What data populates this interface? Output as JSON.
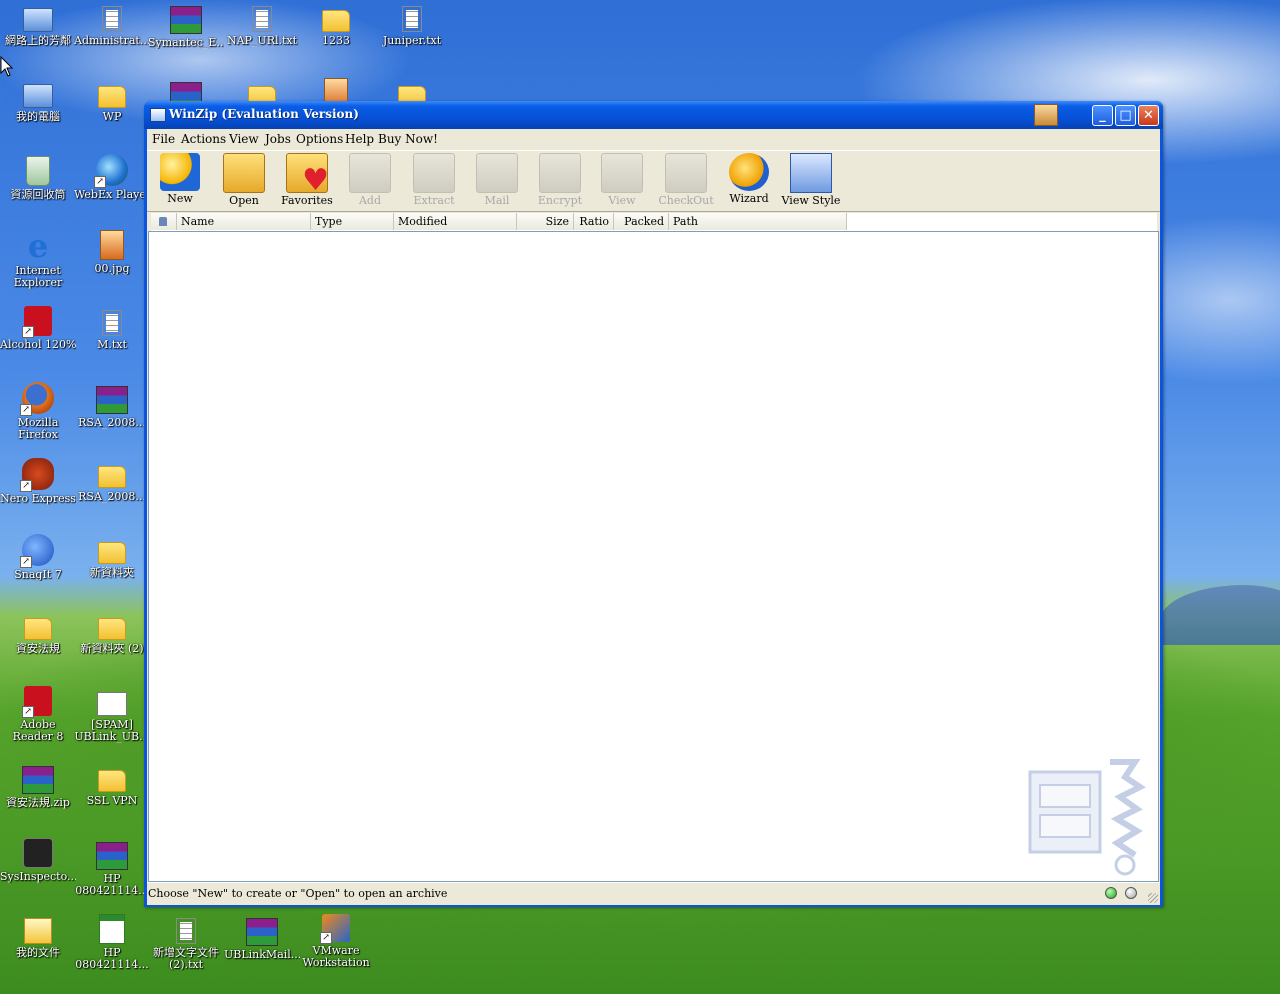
{
  "desktop": {
    "icons": [
      {
        "label": "網路上的芳鄰",
        "icon": "network-icon"
      },
      {
        "label": "Administrat...",
        "icon": "text-icon"
      },
      {
        "label": "Symantec_E...",
        "icon": "rar-icon"
      },
      {
        "label": "NAP_URl.txt",
        "icon": "text-icon"
      },
      {
        "label": "1233",
        "icon": "folder-icon"
      },
      {
        "label": "Juniper.txt",
        "icon": "text-icon"
      },
      {
        "label": "我的電腦",
        "icon": "computer-icon"
      },
      {
        "label": "WP",
        "icon": "folder-icon"
      },
      {
        "label": "資源回收筒",
        "icon": "recycle-bin-icon"
      },
      {
        "label": "WebEx Player",
        "icon": "webex-icon"
      },
      {
        "label": "Internet Explorer",
        "icon": "ie-icon"
      },
      {
        "label": "00.jpg",
        "icon": "image-icon"
      },
      {
        "label": "Alcohol 120%",
        "icon": "alcohol-icon"
      },
      {
        "label": "M.txt",
        "icon": "text-icon"
      },
      {
        "label": "Mozilla Firefox",
        "icon": "firefox-icon"
      },
      {
        "label": "RSA_2008...",
        "icon": "rar-icon"
      },
      {
        "label": "Nero Express",
        "icon": "nero-icon"
      },
      {
        "label": "RSA_2008...",
        "icon": "folder-icon"
      },
      {
        "label": "SnagIt 7",
        "icon": "snagit-icon"
      },
      {
        "label": "新資料夾",
        "icon": "folder-icon"
      },
      {
        "label": "資安法規",
        "icon": "folder-icon"
      },
      {
        "label": "新資料夾 (2)",
        "icon": "folder-icon"
      },
      {
        "label": "Adobe Reader 8",
        "icon": "adobe-reader-icon"
      },
      {
        "label": "[SPAM] UBLink_UB...",
        "icon": "mail-icon"
      },
      {
        "label": "資安法規.zip",
        "icon": "rar-icon"
      },
      {
        "label": "SSL VPN",
        "icon": "folder-icon"
      },
      {
        "label": "SysInspecto...",
        "icon": "sysinspector-icon"
      },
      {
        "label": "HP 080421114...",
        "icon": "rar-icon"
      },
      {
        "label": "我的文件",
        "icon": "documents-icon"
      },
      {
        "label": "HP 080421114...",
        "icon": "excel-icon"
      },
      {
        "label": "新增文字文件 (2).txt",
        "icon": "text-icon"
      },
      {
        "label": "UBLinkMail...",
        "icon": "rar-icon"
      },
      {
        "label": "VMware Workstation",
        "icon": "vmware-icon"
      }
    ]
  },
  "window": {
    "title": "WinZip (Evaluation Version)",
    "controls": {
      "minimize": "_",
      "maximize": "□",
      "close": "✕"
    },
    "menu": [
      "File",
      "Actions",
      "View",
      "Jobs",
      "Options",
      "Help",
      "Buy Now!"
    ],
    "toolbar": [
      {
        "label": "New",
        "icon": "new-icon",
        "enabled": true
      },
      {
        "label": "Open",
        "icon": "open-icon",
        "enabled": true
      },
      {
        "label": "Favorites",
        "icon": "favorites-icon",
        "enabled": true
      },
      {
        "label": "Add",
        "icon": "add-icon",
        "enabled": false
      },
      {
        "label": "Extract",
        "icon": "extract-icon",
        "enabled": false
      },
      {
        "label": "Mail",
        "icon": "mail-icon",
        "enabled": false
      },
      {
        "label": "Encrypt",
        "icon": "encrypt-icon",
        "enabled": false
      },
      {
        "label": "View",
        "icon": "view-icon",
        "enabled": false
      },
      {
        "label": "CheckOut",
        "icon": "checkout-icon",
        "enabled": false
      },
      {
        "label": "Wizard",
        "icon": "wizard-icon",
        "enabled": true
      },
      {
        "label": "View Style",
        "icon": "view-style-icon",
        "enabled": true
      }
    ],
    "columns": [
      "Name",
      "Type",
      "Modified",
      "Size",
      "Ratio",
      "Packed",
      "Path"
    ],
    "status": "Choose \"New\" to create or \"Open\" to open an archive"
  }
}
